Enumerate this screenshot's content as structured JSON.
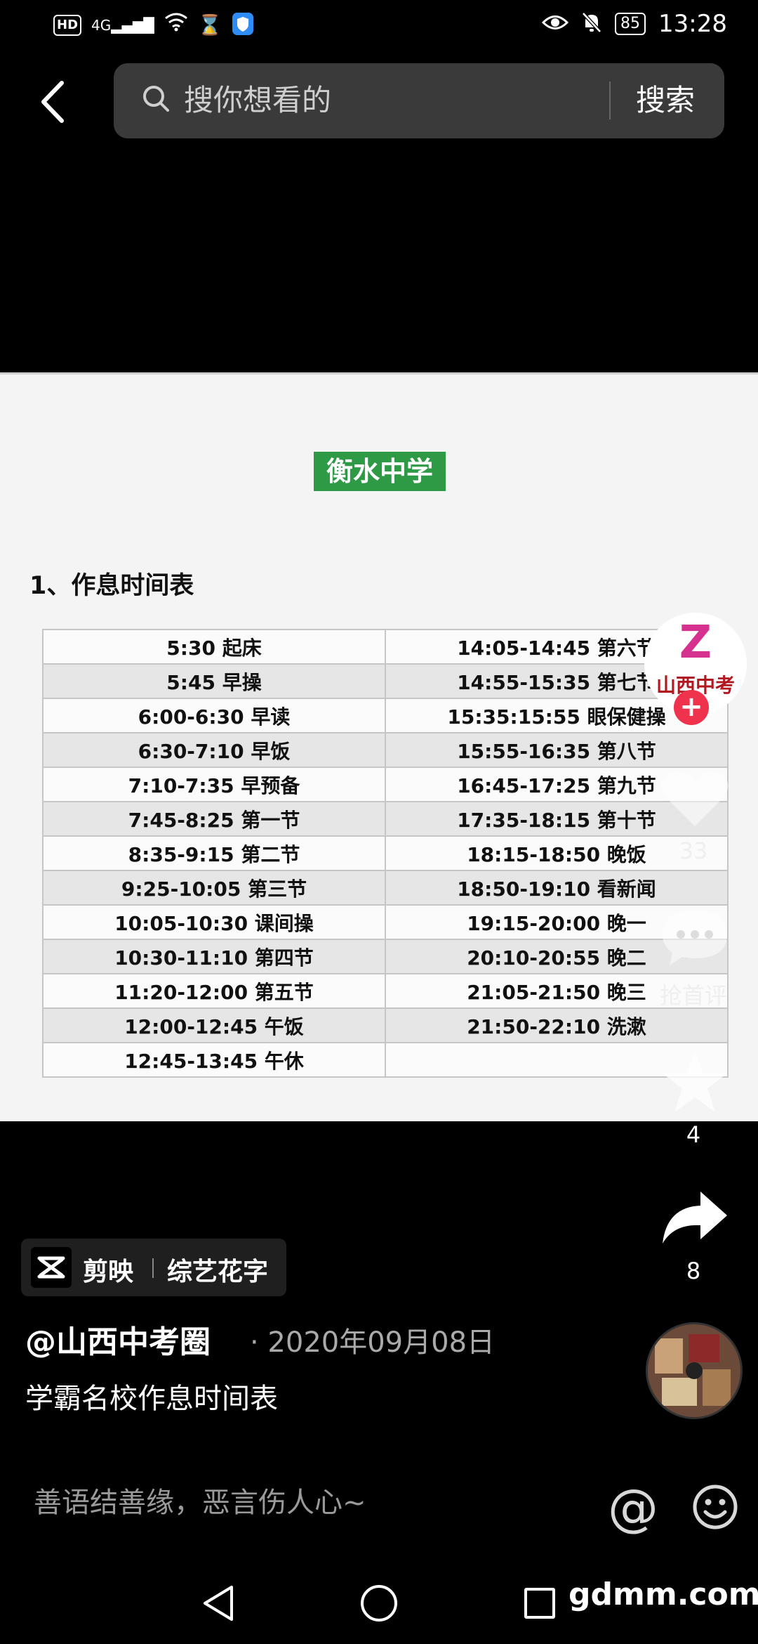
{
  "status_bar": {
    "hd": "HD",
    "network": "4G",
    "battery": "85",
    "time": "13:28"
  },
  "search": {
    "placeholder": "搜你想看的",
    "button_label": "搜索"
  },
  "video": {
    "school_title": "衡水中学",
    "section_heading": "1、作息时间表",
    "schedule_rows": [
      [
        "5:30 起床",
        "14:05-14:45 第六节"
      ],
      [
        "5:45 早操",
        "14:55-15:35 第七节"
      ],
      [
        "6:00-6:30 早读",
        "15:35:15:55 眼保健操"
      ],
      [
        "6:30-7:10 早饭",
        "15:55-16:35 第八节"
      ],
      [
        "7:10-7:35 早预备",
        "16:45-17:25 第九节"
      ],
      [
        "7:45-8:25 第一节",
        "17:35-18:15 第十节"
      ],
      [
        "8:35-9:15 第二节",
        "18:15-18:50 晚饭"
      ],
      [
        "9:25-10:05 第三节",
        "18:50-19:10 看新闻"
      ],
      [
        "10:05-10:30 课间操",
        "19:15-20:00 晚一"
      ],
      [
        "10:30-11:10 第四节",
        "20:10-20:55 晚二"
      ],
      [
        "11:20-12:00 第五节",
        "21:05-21:50 晚三"
      ],
      [
        "12:00-12:45 午饭",
        "21:50-22:10 洗漱"
      ],
      [
        "12:45-13:45 午休",
        ""
      ]
    ]
  },
  "sidebar": {
    "logo_mark": "Z",
    "logo_text": "山西中考",
    "follow": "+",
    "likes": "33",
    "comment_label": "抢首评",
    "favorites": "4",
    "shares": "8"
  },
  "info": {
    "tag_app": "剪映",
    "tag_style": "综艺花字",
    "author": "@山西中考圈",
    "date": "· 2020年09月08日",
    "caption": "学霸名校作息时间表"
  },
  "comment_bar": {
    "placeholder": "善语结善缘，恶言伤人心~",
    "at": "@"
  },
  "watermark": "gdmm.com"
}
